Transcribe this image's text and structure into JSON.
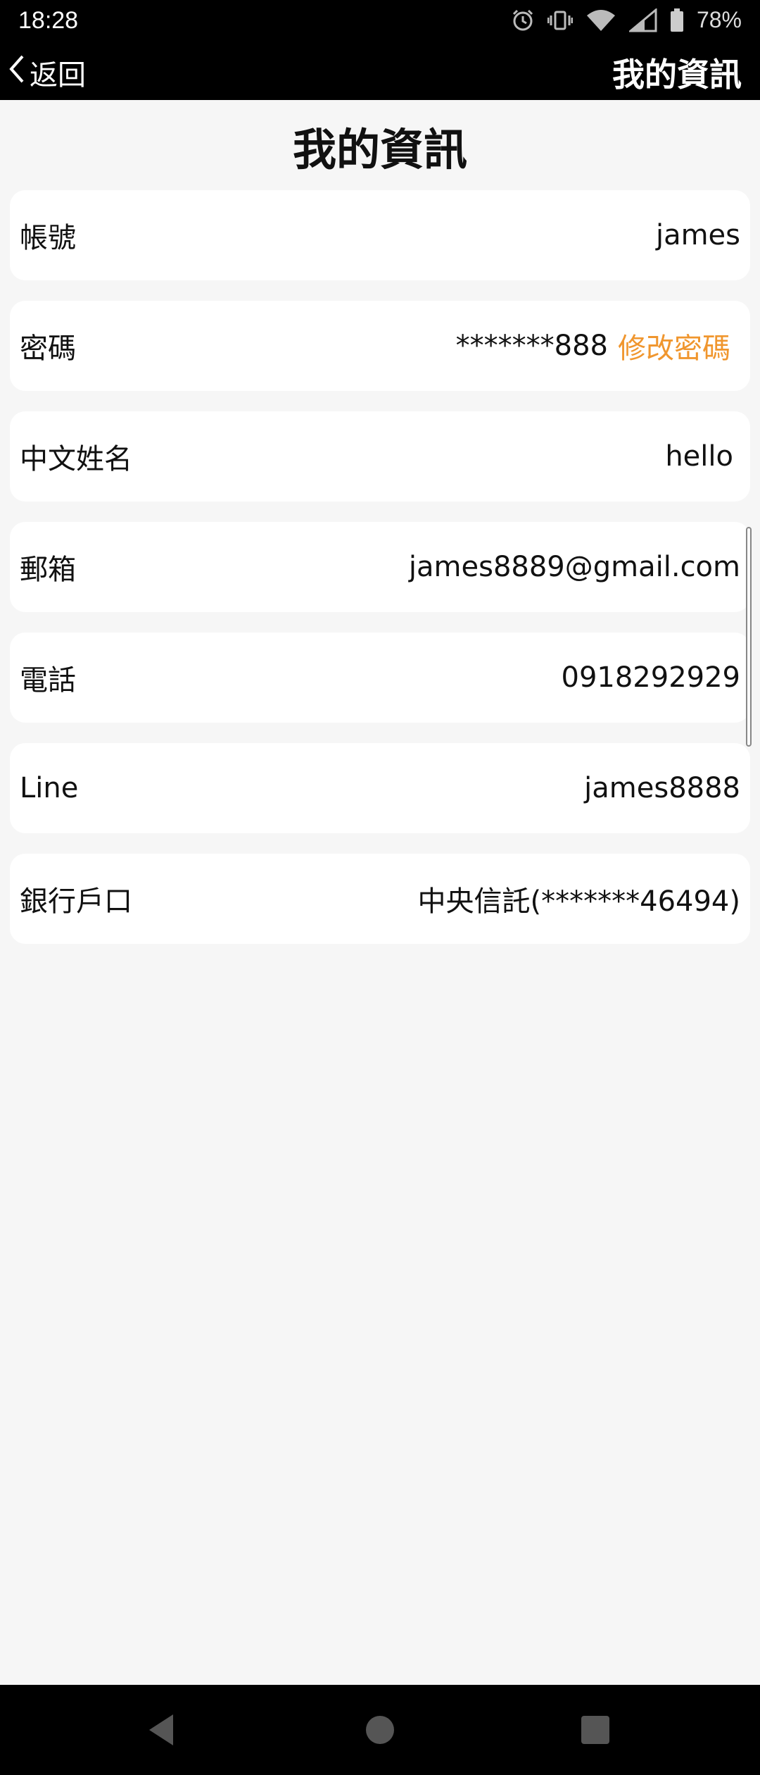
{
  "status_bar": {
    "time": "18:28",
    "battery": "78%",
    "icons": [
      "alarm-icon",
      "vibrate-icon",
      "wifi-icon",
      "signal-icon",
      "battery-icon"
    ]
  },
  "navbar": {
    "back_label": "返回",
    "title": "我的資訊"
  },
  "page": {
    "title": "我的資訊"
  },
  "fields": [
    {
      "label": "帳號",
      "value": "james"
    },
    {
      "label": "密碼",
      "value": "*******888",
      "action": "修改密碼"
    },
    {
      "label": "中文姓名",
      "value": "hello"
    },
    {
      "label": "郵箱",
      "value": "james8889@gmail.com"
    },
    {
      "label": "電話",
      "value": "0918292929"
    },
    {
      "label": "Line",
      "value": "james8888"
    },
    {
      "label": "銀行戶口",
      "value": "中央信託(*******46494)"
    }
  ],
  "colors": {
    "accent": "#f0962e",
    "bar": "#000000",
    "background": "#f6f6f6"
  },
  "bottom_nav": [
    "back-triangle-icon",
    "home-circle-icon",
    "recents-square-icon"
  ]
}
